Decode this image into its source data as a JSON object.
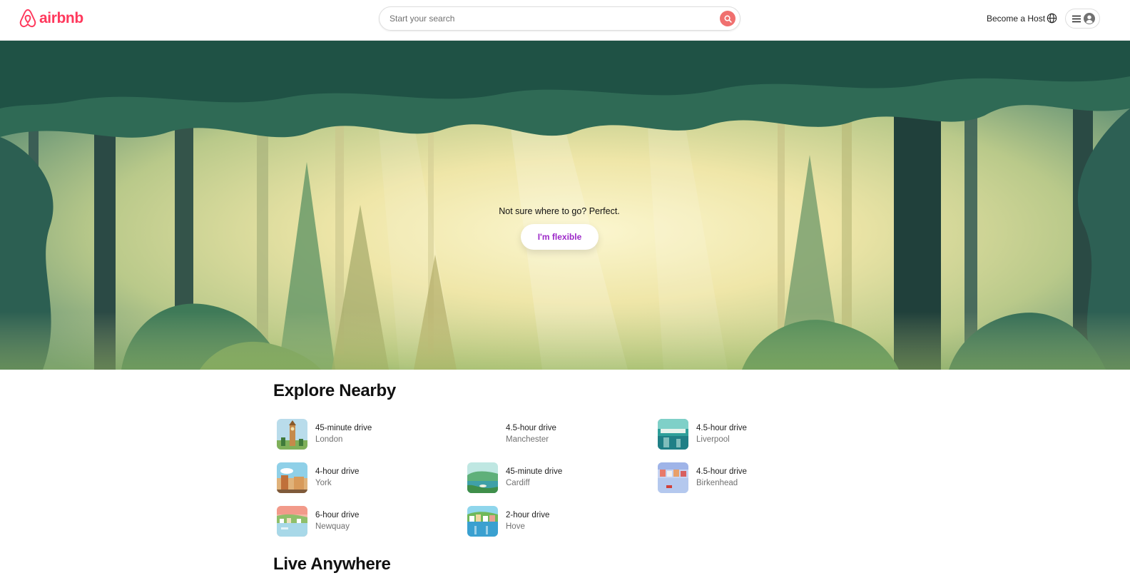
{
  "header": {
    "brand": "airbnb",
    "search_placeholder": "Start your search",
    "become_host": "Become a Host"
  },
  "hero": {
    "tagline": "Not sure where to go? Perfect.",
    "flexible_button": "I'm flexible"
  },
  "explore_nearby": {
    "title": "Explore Nearby",
    "items": [
      {
        "drive": "45-minute drive",
        "city": "London",
        "thumb": "london-thumb"
      },
      {
        "drive": "4.5-hour drive",
        "city": "Manchester",
        "thumb": ""
      },
      {
        "drive": "4.5-hour drive",
        "city": "Liverpool",
        "thumb": "liverpool-thumb"
      },
      {
        "drive": "4-hour drive",
        "city": "York",
        "thumb": "york-thumb"
      },
      {
        "drive": "45-minute drive",
        "city": "Cardiff",
        "thumb": "cardiff-thumb"
      },
      {
        "drive": "4.5-hour drive",
        "city": "Birkenhead",
        "thumb": "birkenhead-thumb"
      },
      {
        "drive": "6-hour drive",
        "city": "Newquay",
        "thumb": "newquay-thumb"
      },
      {
        "drive": "2-hour drive",
        "city": "Hove",
        "thumb": "hove-thumb"
      }
    ]
  },
  "live_anywhere": {
    "title": "Live Anywhere"
  },
  "colors": {
    "brand": "#ff385c",
    "search_button": "#f0706f",
    "flexible_text": "#9c28c8"
  }
}
